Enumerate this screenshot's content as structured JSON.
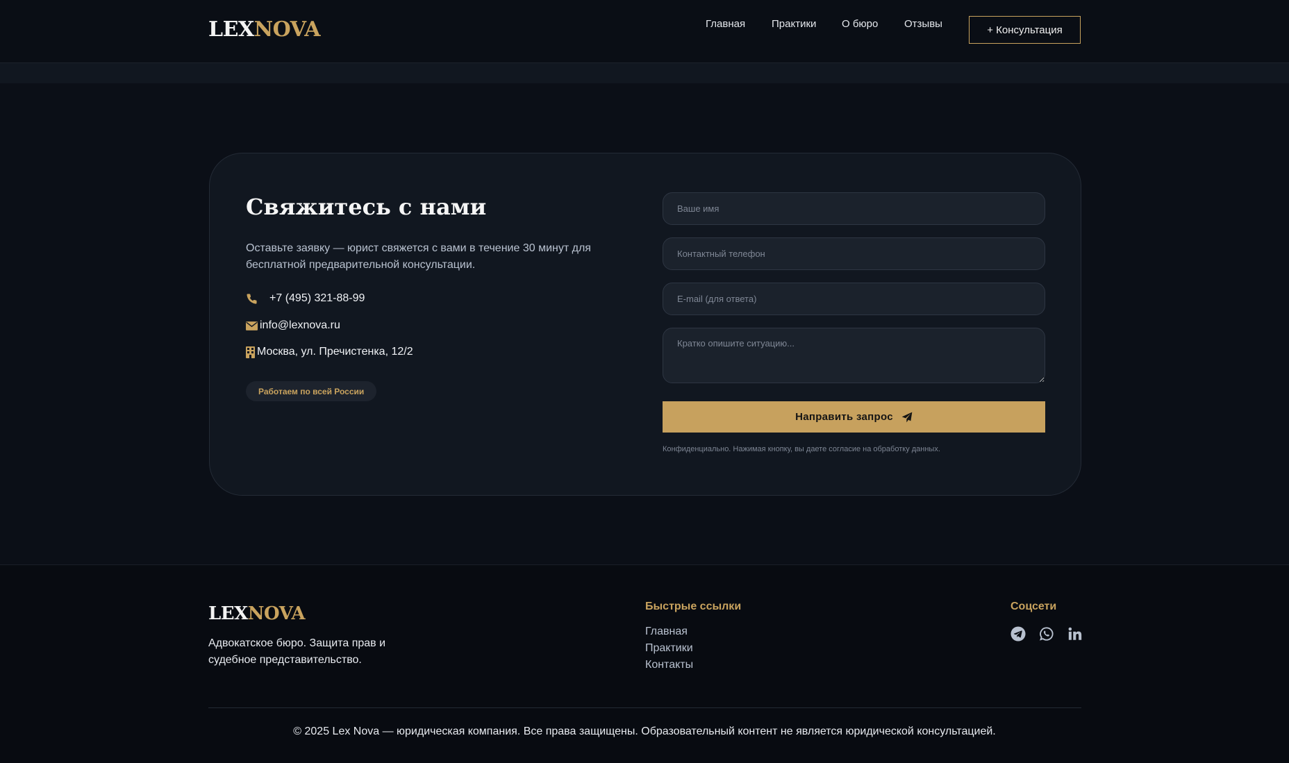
{
  "header": {
    "logo_part1": "LEX",
    "logo_part2": "NOVA",
    "nav": [
      {
        "label": "Главная"
      },
      {
        "label": "Практики"
      },
      {
        "label": "О бюро"
      },
      {
        "label": "Отзывы"
      }
    ],
    "cta_label": "+ Консультация"
  },
  "contact": {
    "title": "Свяжитесь с нами",
    "description": "Оставьте заявку — юрист свяжется с вами в течение 30 минут для бесплатной предварительной консультации.",
    "phone": "+7 (495) 321-88-99",
    "email": "info@lexnova.ru",
    "address": "Москва, ул. Пречистенка, 12/2",
    "badge": "Работаем по всей России",
    "form": {
      "name_placeholder": "Ваше имя",
      "phone_placeholder": "Контактный телефон",
      "email_placeholder": "E-mail (для ответа)",
      "message_placeholder": "Кратко опишите ситуацию...",
      "submit_label": "Направить запрос",
      "consent": "Конфиденциально. Нажимая кнопку, вы даете согласие на обработку данных."
    },
    "icons": [
      "phone-icon",
      "envelope-icon",
      "building-icon",
      "paper-plane-icon"
    ]
  },
  "footer": {
    "logo_part1": "LEX",
    "logo_part2": "NOVA",
    "tagline": "Адвокатское бюро. Защита прав и судебное представительство.",
    "quick_links_title": "Быстрые ссылки",
    "quick_links": [
      {
        "label": "Главная"
      },
      {
        "label": "Практики"
      },
      {
        "label": "Контакты"
      }
    ],
    "socials_title": "Соцсети",
    "socials": [
      "telegram-icon",
      "whatsapp-icon",
      "linkedin-icon"
    ],
    "copyright": "© 2025 Lex Nova — юридическая компания. Все права защищены. Образовательный контент не является юридической консультацией."
  },
  "colors": {
    "background": "#0b0f17",
    "card": "#111720",
    "accent_gold": "#c9a35e",
    "footer": "#080b11"
  }
}
